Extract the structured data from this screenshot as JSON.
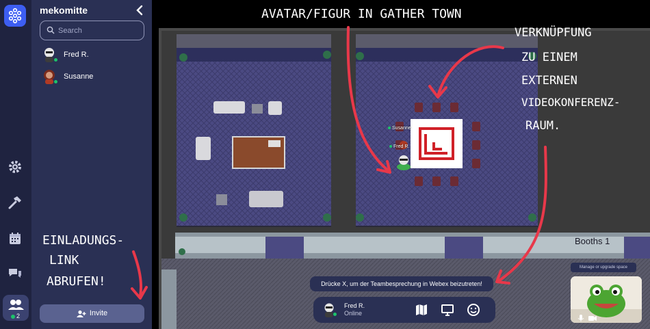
{
  "space": {
    "name": "mekomitte"
  },
  "search": {
    "placeholder": "Search"
  },
  "users": [
    {
      "name": "Fred R.",
      "color": "#e6e6e6"
    },
    {
      "name": "Susanne",
      "color": "#b03a24"
    }
  ],
  "rail": {
    "participant_count": "2"
  },
  "invite": {
    "label": "Invite"
  },
  "map": {
    "booth_label": "Booths 1",
    "avatar_labels": [
      "Susanne",
      "Fred R."
    ]
  },
  "toast": {
    "text": "Drücke X, um der Teambesprechung in Webex beizutreten!"
  },
  "bottom_bar": {
    "user_name": "Fred R.",
    "status": "Online"
  },
  "video": {
    "manage_label": "Manage or upgrade space"
  },
  "annotations": {
    "avatar": "AVATAR/FIGUR IN GATHER TOWN",
    "link_line1": "VERKNÜPFUNG",
    "link_line2": "ZU EINEM",
    "link_line3": "EXTERNEN",
    "link_line4": "VIDEOKONFERENZ-",
    "link_line5": "RAUM.",
    "invite_line1": "EINLADUNGS-",
    "invite_line2": "LINK",
    "invite_line3": "ABRUFEN!"
  },
  "colors": {
    "rail": "#1f2340",
    "panel": "#2a3054",
    "accent": "#3d5ef2",
    "online": "#1ec36b",
    "floor": "#4b4a82",
    "annotation_arrow": "#e8384a"
  }
}
